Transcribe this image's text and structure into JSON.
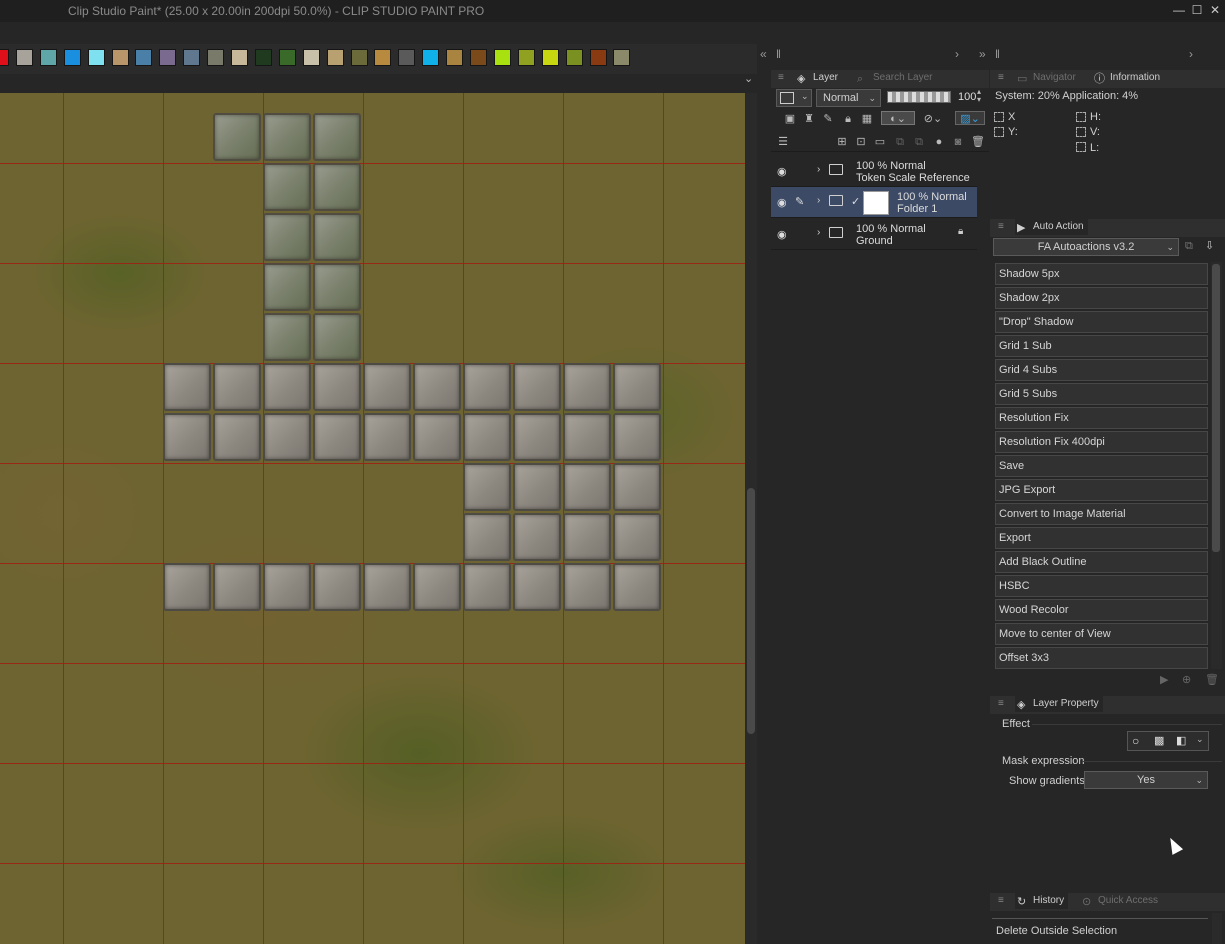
{
  "window": {
    "title": "Clip Studio Paint* (25.00 x 20.00in 200dpi 50.0%)  - CLIP STUDIO PAINT PRO",
    "minimize": "—",
    "restore": "☐",
    "close": "✕"
  },
  "palette": {
    "colors": [
      "#e0101a",
      "#a8a39a",
      "#5ea6a8",
      "#1a8fe0",
      "#7fe0f0",
      "#b9956a",
      "#4a7fa8",
      "#7a6a8f",
      "#5f7890",
      "#7a7a6a",
      "#c8b89a",
      "#1f3a1f",
      "#3a6a2a",
      "#c8c0a8",
      "#b8a070",
      "#6a6a3a",
      "#b88a40",
      "#5a5a5a",
      "#10b0e8",
      "#a88440",
      "#7a4a1a",
      "#a8e010",
      "#90a020",
      "#c8d810",
      "#7a9020",
      "#8a3a10",
      "#8a8a6a"
    ],
    "expand_glyph": "⌄"
  },
  "layer_panel": {
    "tabs": {
      "layer": "Layer",
      "search_layer": "Search Layer"
    },
    "blend_mode": "Normal",
    "opacity": "100",
    "layers": [
      {
        "percent": "100 %",
        "mode": "Normal",
        "name": "Token Scale Reference"
      },
      {
        "percent": "100 %",
        "mode": "Normal",
        "name": "Folder 1"
      },
      {
        "percent": "100 %",
        "mode": "Normal",
        "name": "Ground"
      }
    ]
  },
  "info_panel": {
    "tabs": {
      "navigator": "Navigator",
      "information": "Information"
    },
    "system_line": "System: 20%  Application:  4%",
    "x": "X",
    "y": "Y:",
    "h": "H:",
    "v": "V:",
    "l": "L:"
  },
  "auto_action": {
    "tab": "Auto Action",
    "set": "FA Autoactions v3.2",
    "items": [
      "Shadow 5px",
      "Shadow 2px",
      "\"Drop\" Shadow",
      "Grid 1 Sub",
      "Grid 4 Subs",
      "Grid 5 Subs",
      "Resolution Fix",
      "Resolution Fix 400dpi",
      "Save",
      "JPG Export",
      "Convert to Image Material",
      "Export",
      "Add Black Outline",
      "HSBC",
      "Wood Recolor",
      "Move to center of View",
      "Offset 3x3"
    ]
  },
  "layer_property": {
    "tab": "Layer Property",
    "effect": "Effect",
    "mask_expression": "Mask expression",
    "show_gradients_label": "Show gradients",
    "show_gradients_value": "Yes"
  },
  "history": {
    "tabs": {
      "history": "History",
      "quick_access": "Quick Access"
    },
    "last_item": "Delete Outside Selection"
  }
}
